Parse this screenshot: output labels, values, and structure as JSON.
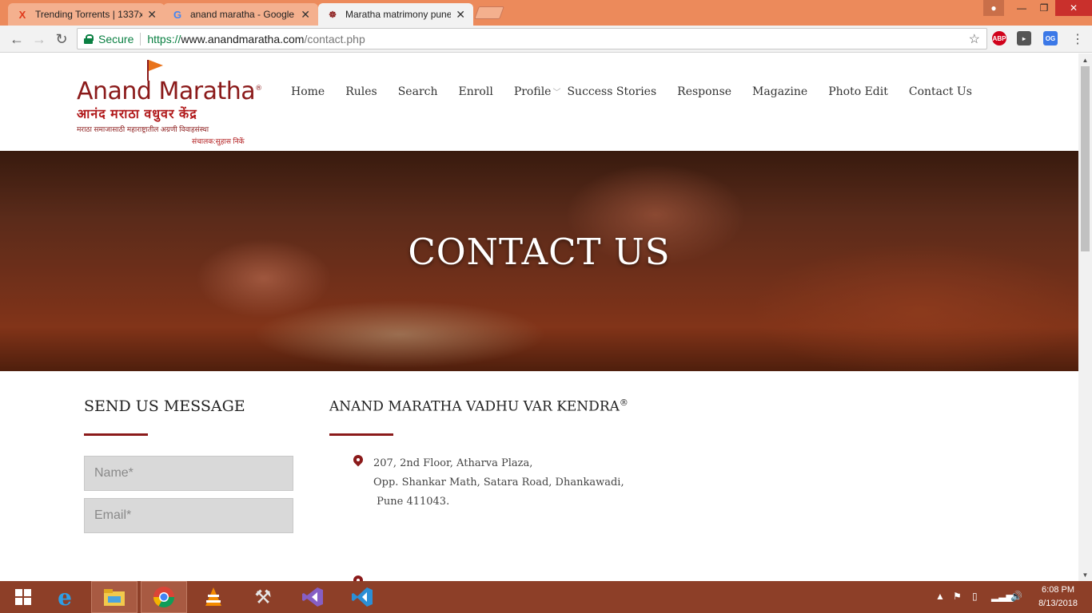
{
  "browser": {
    "tabs": [
      {
        "title": "Trending Torrents | 1337x",
        "favicon": "1337x-icon",
        "active": false
      },
      {
        "title": "anand maratha - Google",
        "favicon": "google-icon",
        "active": false
      },
      {
        "title": "Maratha matrimony pune",
        "favicon": "site-icon",
        "active": true
      }
    ],
    "omnibox": {
      "secure_label": "Secure",
      "scheme": "https://",
      "host": "www.anandmaratha.com",
      "path": "/contact.php"
    },
    "extensions": [
      {
        "name": "adblock-plus-icon",
        "label": "ABP",
        "color": "#d0021b"
      },
      {
        "name": "cast-icon",
        "label": "",
        "color": "#555555"
      },
      {
        "name": "extension-og-icon",
        "label": "OG",
        "color": "#3b78e7"
      }
    ],
    "accent_color": "#ec8a5b"
  },
  "site": {
    "logo": {
      "brand": "Anand Maratha",
      "devanagari": "आनंद मराठा वधुवर केंद्र",
      "tagline": "मराठा समाजासाठी महाराष्ट्रातील अग्रणी विवाहसंस्था",
      "director": "संचालक:सुहास निकें"
    },
    "nav": [
      "Home",
      "Rules",
      "Search",
      "Enroll",
      "Profile",
      "Success Stories",
      "Response",
      "Magazine",
      "Photo Edit",
      "Contact Us"
    ],
    "hero_title": "CONTACT US",
    "send_heading": "SEND US MESSAGE",
    "form": {
      "name_placeholder": "Name*",
      "email_placeholder": "Email*"
    },
    "kendra": {
      "heading": "ANAND MARATHA VADHU VAR KENDRA",
      "reg": "®",
      "address_line1": "207, 2nd Floor, Atharva Plaza,",
      "address_line2": "Opp. Shankar Math, Satara Road, Dhankawadi,",
      "address_line3": " Pune 411043."
    },
    "brand_color": "#8b1a1a"
  },
  "taskbar": {
    "apps": [
      "file-explorer-icon",
      "chrome-icon",
      "vlc-icon",
      "tools-icon",
      "visual-studio-icon",
      "vscode-icon"
    ],
    "time": "6:08 PM",
    "date": "8/13/2018"
  }
}
